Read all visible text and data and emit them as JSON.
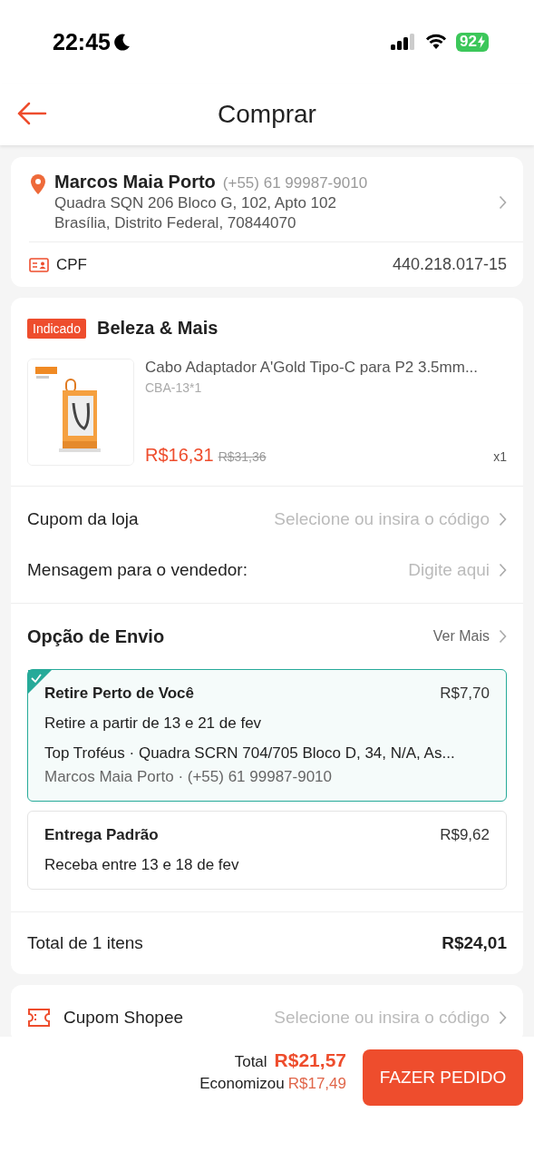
{
  "status_bar": {
    "time": "22:45",
    "battery": "92"
  },
  "header": {
    "title": "Comprar"
  },
  "address": {
    "name": "Marcos Maia Porto",
    "phone": "(+55) 61 99987-9010",
    "line_1": "Quadra SQN 206 Bloco G, 102, Apto 102",
    "line_2": "Brasília, Distrito Federal, 70844070",
    "id_label": "CPF",
    "id_value": "440.218.017-15"
  },
  "store": {
    "badge": "Indicado",
    "name": "Beleza & Mais",
    "product": {
      "kind": "picture",
      "title": "Cabo Adaptador A'Gold Tipo-C para P2 3.5mm...",
      "variant": "CBA-13*1",
      "price": "R$16,31",
      "old_price": "R$31,36",
      "quantity": "x1"
    },
    "rows": [
      {
        "label": "Cupom da loja",
        "value": "Selecione ou insira o código"
      },
      {
        "label": "Mensagem para o vendedor:",
        "value": "Digite aqui"
      }
    ],
    "shipping": {
      "title": "Opção de Envio",
      "more": "Ver Mais",
      "options": [
        {
          "name": "Retire Perto de Você",
          "price": "R$7,70",
          "selected": true,
          "lines": [
            "Retire a partir de 13 e 21 de fev",
            "Top Troféus · Quadra SCRN 704/705 Bloco D, 34, N/A, As..."
          ],
          "contact": "Marcos Maia Porto · (+55) 61 99987-9010"
        },
        {
          "name": "Entrega Padrão",
          "price": "R$9,62",
          "selected": false,
          "lines": [
            "Receba entre 13 e 18 de fev"
          ]
        }
      ]
    },
    "total_label": "Total de 1 itens",
    "total_value": "R$24,01"
  },
  "platform_coupon": {
    "label": "Cupom Shopee",
    "value": "Selecione ou insira o código"
  },
  "footer": {
    "total_label": "Total",
    "total_value": "R$21,57",
    "saved_label": "Economizou",
    "saved_value": "R$17,49",
    "button": "FAZER PEDIDO"
  }
}
